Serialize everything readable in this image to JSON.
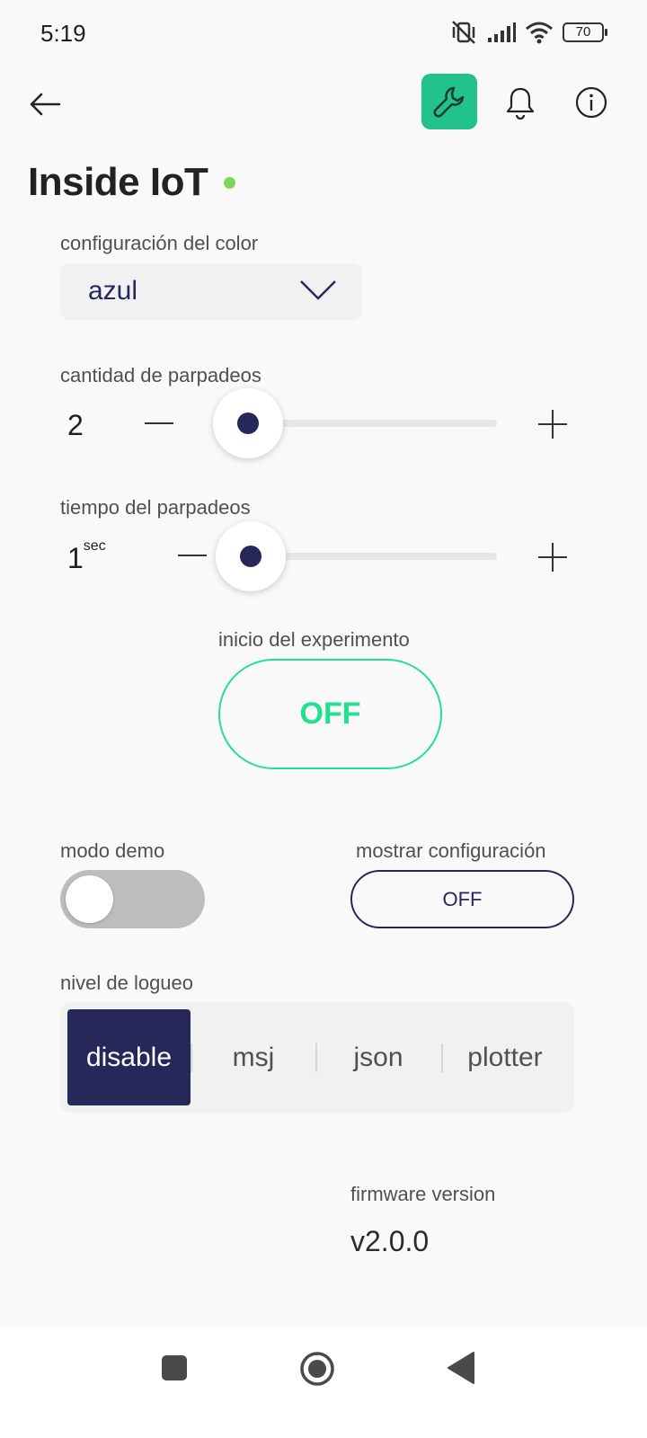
{
  "status_bar": {
    "time": "5:19",
    "battery": "70"
  },
  "header": {
    "title": "Inside IoT",
    "online_color": "#7dd65a",
    "icons": [
      "back-arrow-icon",
      "wrench-icon",
      "bell-icon",
      "info-icon"
    ],
    "accent": "#21c38a"
  },
  "color_config": {
    "label": "configuración del color",
    "value": "azul"
  },
  "blink_count": {
    "label": "cantidad de parpadeos",
    "value": "2",
    "level": 0.0
  },
  "blink_time": {
    "label": "tiempo del parpadeos",
    "value": "1",
    "unit": "sec",
    "level": 0.0
  },
  "experiment": {
    "label": "inicio del experimento",
    "button": "OFF",
    "color": "#21e08e"
  },
  "demo_mode": {
    "label": "modo demo",
    "on": false
  },
  "show_config": {
    "label": "mostrar configuración",
    "button": "OFF"
  },
  "log_level": {
    "label": "nivel de logueo",
    "options": [
      "disable",
      "msj",
      "json",
      "plotter"
    ],
    "selected": "disable"
  },
  "firmware": {
    "label": "firmware version",
    "value": "v2.0.0"
  },
  "nav_icons": [
    "recents-square-icon",
    "home-circle-icon",
    "back-triangle-icon"
  ]
}
